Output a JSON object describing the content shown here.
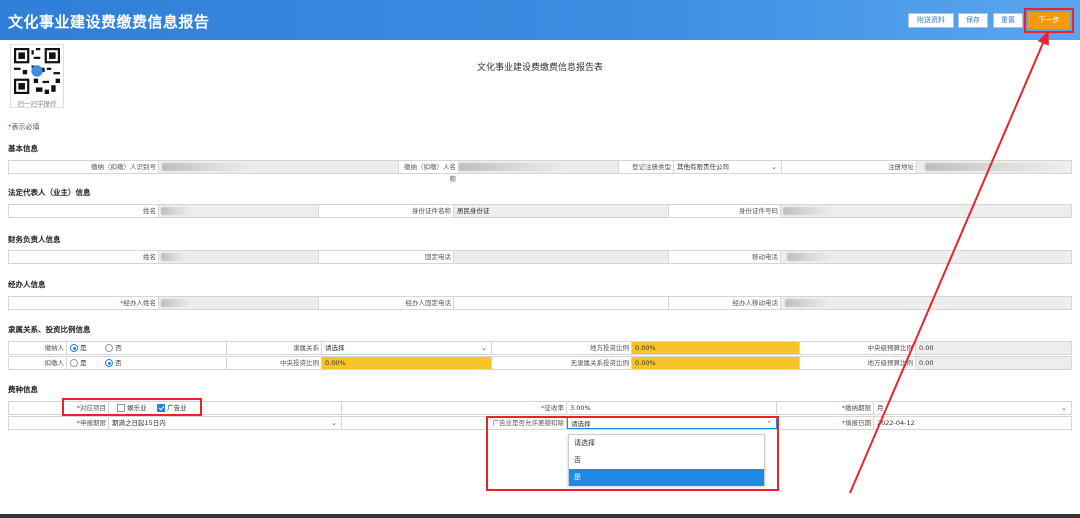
{
  "header": {
    "title": "文化事业建设费缴费信息报告",
    "buttons": {
      "attachments": "附送资料",
      "save": "保存",
      "reset": "重置",
      "next": "下一步"
    }
  },
  "qr": {
    "caption": "扫一扫学操作"
  },
  "page_title": "文化事业建设费缴费信息报告表",
  "required_note": "表示必填",
  "required_mark": "*",
  "sections": {
    "basic": {
      "title": "基本信息",
      "taxpayer_id_label": "缴纳（扣缴）人识别号",
      "taxpayer_name_label": "缴纳（扣缴）人名称",
      "reg_type_label": "登记注册类型",
      "reg_type_value": "其他有限责任公司",
      "reg_address_label": "注册地址"
    },
    "legal": {
      "title": "法定代表人（业主）信息",
      "name_label": "姓名",
      "id_type_label": "身份证件名称",
      "id_type_value": "居民身份证",
      "id_number_label": "身份证件号码"
    },
    "finance": {
      "title": "财务负责人信息",
      "name_label": "姓名",
      "phone_label": "固定电话",
      "mobile_label": "移动电话"
    },
    "agent": {
      "title": "经办人信息",
      "name_label": "经办人姓名",
      "phone_label": "经办人固定电话",
      "mobile_label": "经办人移动电话"
    },
    "affiliation": {
      "title": "隶属关系、投资比例信息",
      "payer_label": "缴纳人",
      "withholder_label": "扣缴人",
      "yes": "是",
      "no": "否",
      "affiliation_label": "隶属关系",
      "affiliation_value": "请选择",
      "local_ratio_label": "地方投资比例",
      "local_ratio_value": "0.00%",
      "central_ratio_label": "中央投资比例",
      "central_ratio_value": "0.00%",
      "central_level_label": "中央级预算比例",
      "central_level_value": "0.00",
      "none_ratio_label": "无隶属关系投资比例",
      "none_ratio_value": "0.00%",
      "local_level_label": "地方级预算比例",
      "local_level_value": "0.00"
    },
    "fee": {
      "title": "费种信息",
      "project_label": "对应项目",
      "entertainment": "娱乐业",
      "advertising": "广告业",
      "rate_label": "征收率",
      "rate_value": "3.00%",
      "period_label": "缴纳期限",
      "period_value": "月",
      "report_period_label": "申报期限",
      "report_period_value": "期满之日起15日内",
      "allow_deduct_label": "广告业是否允许差额扣除",
      "allow_deduct_value": "请选择",
      "fill_date_label": "填报日期",
      "fill_date_value": "2022-04-12"
    }
  },
  "dropdown_options": [
    "请选择",
    "否",
    "是"
  ]
}
